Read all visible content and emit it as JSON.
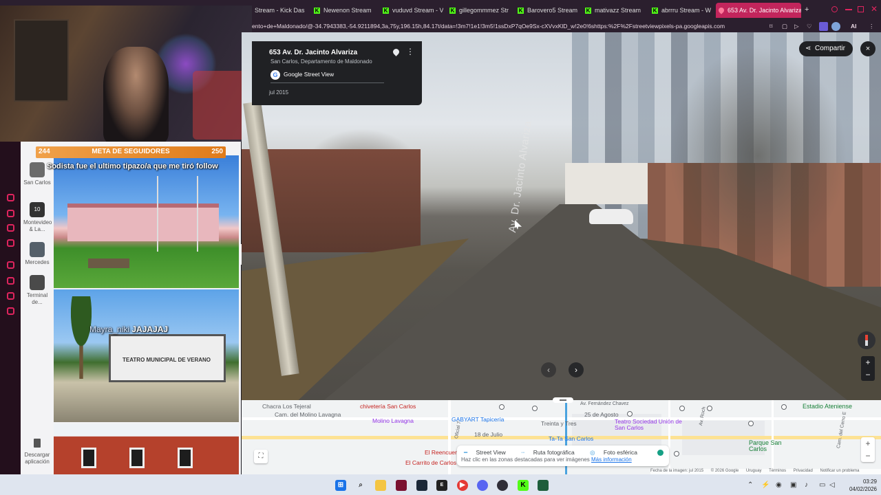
{
  "browser": {
    "tabs": [
      {
        "label": "Stream - Kick Das",
        "kind": "plain"
      },
      {
        "label": "Newenon Stream",
        "kind": "kick"
      },
      {
        "label": "vuduvd Stream - V",
        "kind": "kick"
      },
      {
        "label": "gillegommmez Str",
        "kind": "kick"
      },
      {
        "label": "Barovero5 Stream",
        "kind": "kick"
      },
      {
        "label": "mativazz Stream",
        "kind": "kick"
      },
      {
        "label": "abrrru Stream - W",
        "kind": "kick"
      },
      {
        "label": "653 Av. Dr. Jacinto Alvariza",
        "kind": "maps",
        "active": true
      }
    ],
    "new_tab_icon": "+",
    "url": "ento+de+Maldonado/@-34.7943383,-54.9211894,3a,75y,196.15h,84.17t/data=!3m7!1e1!3m5!1ssDxP7qOe9Sx-cXVvxKlD_w!2e0!6shttps:%2F%2Fstreetviewpixels-pa.googleapis.com",
    "ai_label": "AI"
  },
  "overlay": {
    "follow_goal": {
      "current": "244",
      "title": "META DE SEGUIDORES",
      "target": "250"
    },
    "follow_message": "Sodista fue el ultimo tipazo/a que me tiró follow",
    "photo_message_user": "Mayra_niki",
    "photo_message_text": "JAJAJAJ",
    "photo2_sign": "TEATRO MUNICIPAL DE VERANO"
  },
  "sidepanel": {
    "categories": [
      {
        "label": "San Carlos",
        "color": "#6b6b6b"
      },
      {
        "label": "Montevideo & La...",
        "color": "#333333",
        "badge": "10"
      },
      {
        "label": "Mercedes",
        "color": "#55606a"
      },
      {
        "label": "Terminal de...",
        "color": "#4a4a4a"
      }
    ],
    "download_label": "Descargar aplicación"
  },
  "streetview": {
    "title": "653 Av. Dr. Jacinto Alvariza",
    "subtitle": "San Carlos, Departamento de Maldonado",
    "provider": "Google Street View",
    "date": "jul 2015",
    "street_label": "Av. Dr. Jacinto Alvariza",
    "share_label": "Compartir",
    "close_icon": "×",
    "zoom_in": "+",
    "zoom_out": "−",
    "prev_arrow": "‹",
    "next_arrow": "›"
  },
  "map": {
    "labels": [
      {
        "text": "Chacra Los Tejeral",
        "cls": ""
      },
      {
        "text": "chivetería San Carlos",
        "cls": "poi"
      },
      {
        "text": "Cam. del Molino Lavagna",
        "cls": ""
      },
      {
        "text": "Molino Lavagna",
        "cls": "purple"
      },
      {
        "text": "GABYART Tapicería",
        "cls": "blue"
      },
      {
        "text": "Treinta y Tres",
        "cls": ""
      },
      {
        "text": "25 de Agosto",
        "cls": ""
      },
      {
        "text": "Teatro Sociedad Unión de San Carlos",
        "cls": "purple"
      },
      {
        "text": "Estadio Ateniense",
        "cls": "green"
      },
      {
        "text": "18 de Julio",
        "cls": ""
      },
      {
        "text": "Ta-Ta San Carlos",
        "cls": "blue"
      },
      {
        "text": "Parque San Carlos",
        "cls": "green"
      },
      {
        "text": "El Reencuentr",
        "cls": "poi"
      },
      {
        "text": "El Carrito de Carlos",
        "cls": "poi"
      },
      {
        "text": "Oficial 7",
        "cls": ""
      },
      {
        "text": "Av. Roch",
        "cls": ""
      },
      {
        "text": "Av. Fernández Chavez",
        "cls": ""
      },
      {
        "text": "Cam. del Cerro E",
        "cls": ""
      }
    ],
    "legend": {
      "street_view": "Street View",
      "photo_route": "Ruta fotográfica",
      "sphere": "Foto esférica",
      "hint": "Haz clic en las zonas destacadas para ver imágenes",
      "link": "Más información"
    },
    "attribution": [
      "Fecha de la imagen: jul 2015",
      "© 2026 Google",
      "Uruguay",
      "Términos",
      "Privacidad",
      "Notificar un problema"
    ]
  },
  "taskbar": {
    "time": "03:29",
    "date": "04/02/2026"
  },
  "colors": {
    "accent": "#c2255c",
    "kick": "#53fc18",
    "follow_bar": "#e07b1a"
  }
}
